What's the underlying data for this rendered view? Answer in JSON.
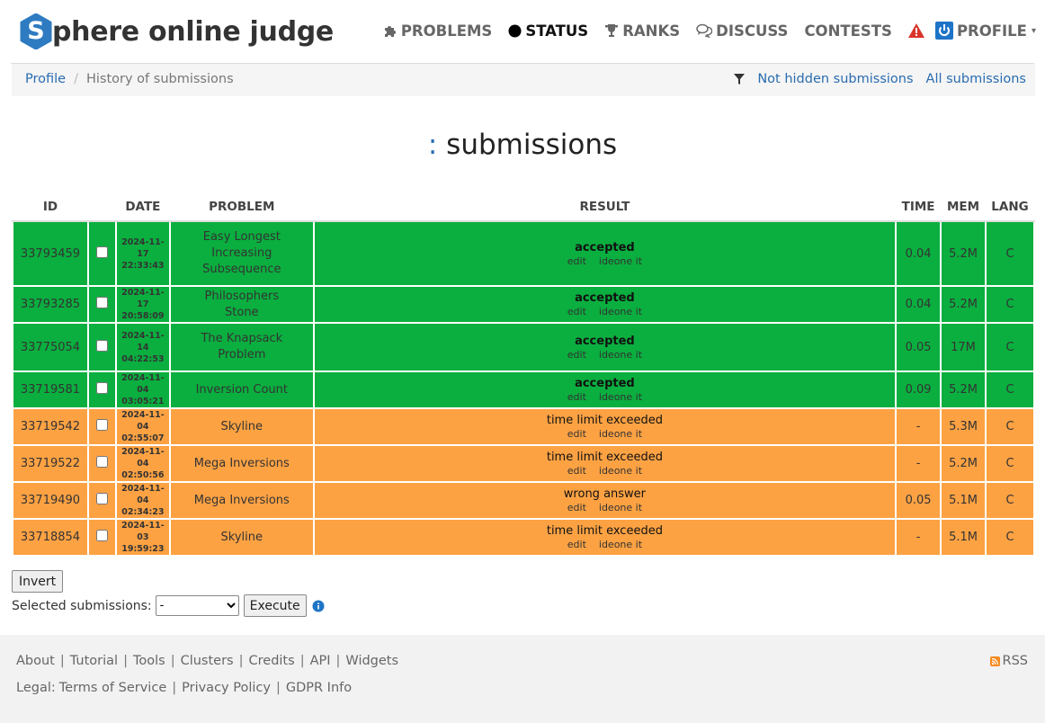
{
  "brand": {
    "logo_letter": "S",
    "logo_text": "phere online judge",
    "logo_color": "#2e7bc2"
  },
  "nav": {
    "problems": "PROBLEMS",
    "status": "STATUS",
    "ranks": "RANKS",
    "discuss": "DISCUSS",
    "contests": "CONTESTS",
    "profile": "PROFILE"
  },
  "breadcrumb": {
    "profile": "Profile",
    "current": "History of submissions",
    "not_hidden": "Not hidden submissions",
    "all": "All submissions"
  },
  "title": {
    "colon": ":",
    "text": "submissions"
  },
  "table": {
    "headers": {
      "id": "ID",
      "date": "DATE",
      "problem": "PROBLEM",
      "result": "RESULT",
      "time": "TIME",
      "mem": "MEM",
      "lang": "LANG"
    },
    "edit_label": "edit",
    "ideone_label": "ideone it",
    "rows": [
      {
        "id": "33793459",
        "date": "2024-11-17",
        "time_of_day": "22:33:43",
        "problem": "Easy Longest Increasing Subsequence",
        "result": "accepted",
        "time": "0.04",
        "mem": "5.2M",
        "lang": "C",
        "status": "ok"
      },
      {
        "id": "33793285",
        "date": "2024-11-17",
        "time_of_day": "20:58:09",
        "problem": "Philosophers Stone",
        "result": "accepted",
        "time": "0.04",
        "mem": "5.2M",
        "lang": "C",
        "status": "ok"
      },
      {
        "id": "33775054",
        "date": "2024-11-14",
        "time_of_day": "04:22:53",
        "problem": "The Knapsack Problem",
        "result": "accepted",
        "time": "0.05",
        "mem": "17M",
        "lang": "C",
        "status": "ok"
      },
      {
        "id": "33719581",
        "date": "2024-11-04",
        "time_of_day": "03:05:21",
        "problem": "Inversion Count",
        "result": "accepted",
        "time": "0.09",
        "mem": "5.2M",
        "lang": "C",
        "status": "ok"
      },
      {
        "id": "33719542",
        "date": "2024-11-04",
        "time_of_day": "02:55:07",
        "problem": "Skyline",
        "result": "time limit exceeded",
        "time": "-",
        "mem": "5.3M",
        "lang": "C",
        "status": "bad"
      },
      {
        "id": "33719522",
        "date": "2024-11-04",
        "time_of_day": "02:50:56",
        "problem": "Mega Inversions",
        "result": "time limit exceeded",
        "time": "-",
        "mem": "5.2M",
        "lang": "C",
        "status": "bad"
      },
      {
        "id": "33719490",
        "date": "2024-11-04",
        "time_of_day": "02:34:23",
        "problem": "Mega Inversions",
        "result": "wrong answer",
        "time": "0.05",
        "mem": "5.1M",
        "lang": "C",
        "status": "bad"
      },
      {
        "id": "33718854",
        "date": "2024-11-03",
        "time_of_day": "19:59:23",
        "problem": "Skyline",
        "result": "time limit exceeded",
        "time": "-",
        "mem": "5.1M",
        "lang": "C",
        "status": "bad"
      }
    ]
  },
  "controls": {
    "invert": "Invert",
    "selected_label": "Selected submissions:",
    "select_value": "-",
    "execute": "Execute"
  },
  "footer": {
    "links": [
      "About",
      "Tutorial",
      "Tools",
      "Clusters",
      "Credits",
      "API",
      "Widgets"
    ],
    "legal_label": "Legal:",
    "legal_links": [
      "Terms of Service",
      "Privacy Policy",
      "GDPR Info"
    ],
    "rss": "RSS"
  },
  "colors": {
    "accepted": "#0aaf3f",
    "failed": "#fda243",
    "link": "#2a6cb0",
    "alert": "#d9342b"
  }
}
